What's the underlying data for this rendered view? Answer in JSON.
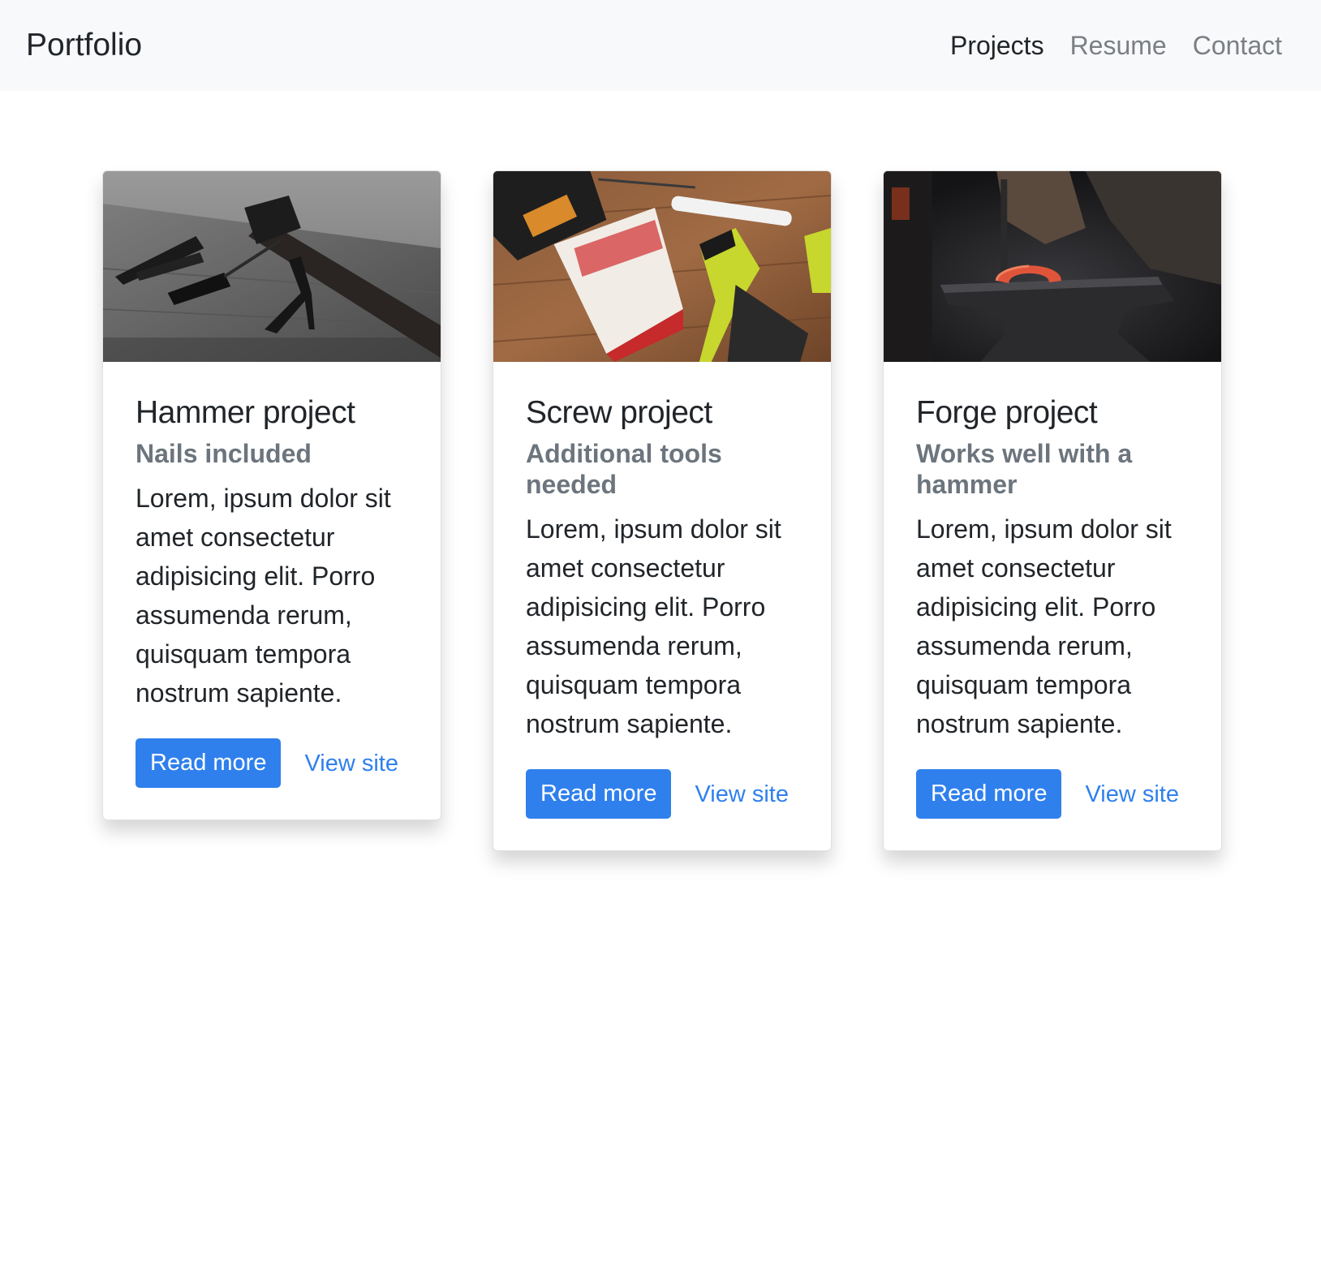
{
  "navbar": {
    "brand": "Portfolio",
    "links": [
      {
        "label": "Projects",
        "active": true
      },
      {
        "label": "Resume",
        "active": false
      },
      {
        "label": "Contact",
        "active": false
      }
    ]
  },
  "cards": [
    {
      "image_subject": "hand tools on wooden board (black and white)",
      "title": "Hammer project",
      "subtitle": "Nails included",
      "text": "Lorem, ipsum dolor sit amet consectetur adipisicing elit. Porro assumenda rerum, quisquam tempora nostrum sapiente.",
      "primary_label": "Read more",
      "secondary_label": "View site"
    },
    {
      "image_subject": "drill and screw boxes on wooden table",
      "title": "Screw project",
      "subtitle": "Additional tools needed",
      "text": "Lorem, ipsum dolor sit amet consectetur adipisicing elit. Porro assumenda rerum, quisquam tempora nostrum sapiente.",
      "primary_label": "Read more",
      "secondary_label": "View site"
    },
    {
      "image_subject": "blacksmith forging a horseshoe on an anvil",
      "title": "Forge project",
      "subtitle": "Works well with a hammer",
      "text": "Lorem, ipsum dolor sit amet consectetur adipisicing elit. Porro assumenda rerum, quisquam tempora nostrum sapiente.",
      "primary_label": "Read more",
      "secondary_label": "View site"
    }
  ],
  "colors": {
    "primary": "#2f80ed",
    "navbar_bg": "#f8f9fa",
    "muted": "#6c757d"
  }
}
